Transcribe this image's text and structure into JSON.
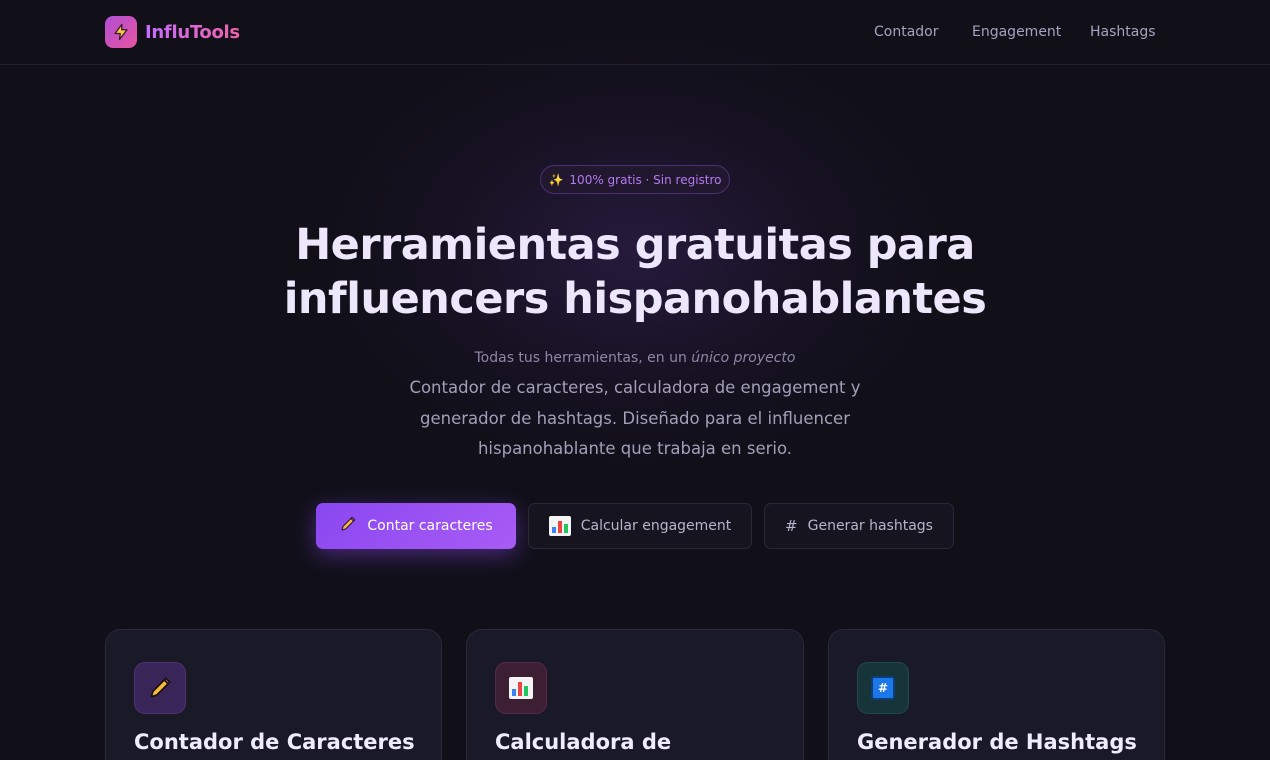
{
  "header": {
    "logo_text": "InfluTools",
    "nav": [
      "Contador",
      "Engagement",
      "Hashtags"
    ]
  },
  "hero": {
    "badge": "100% gratis · Sin registro",
    "title_line1": "Herramientas gratuitas para",
    "title_line2": "influencers hispanohablantes",
    "kicker_plain": "Todas tus herramientas, en un ",
    "kicker_em": "único proyecto",
    "description": "Contador de caracteres, calculadora de engagement y generador de hashtags. Diseñado para el influencer hispanohablante que trabaja en serio."
  },
  "buttons": {
    "primary": "Contar caracteres",
    "engagement": "Calcular engagement",
    "hashtags": "Generar hashtags",
    "hash_symbol": "#"
  },
  "cards": [
    {
      "title": "Contador de Caracteres",
      "icon": "pencil-icon"
    },
    {
      "title": "Calculadora de",
      "icon": "bar-chart-icon"
    },
    {
      "title": "Generador de Hashtags",
      "icon": "hashtag-icon",
      "icon_text": "#"
    }
  ],
  "colors": {
    "background": "#111019",
    "accent": "#8a47f0",
    "logo_gradient_start": "#b04fd6",
    "logo_gradient_end": "#e8549f"
  }
}
